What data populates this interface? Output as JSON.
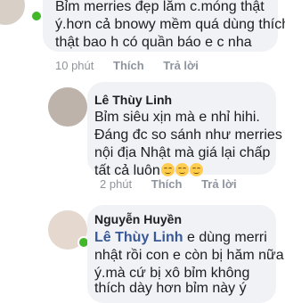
{
  "comments": [
    {
      "lines": [
        "Bỉm merries đẹp lắm c.móng thật",
        "ý.hơn cả bnowy mềm quá dùng thích",
        "thật bao h có quần báo e c nha"
      ],
      "time": "10 phút",
      "like": "Thích",
      "reply": "Trả lời"
    },
    {
      "author": "Lê Thùy Linh",
      "lines": [
        "Bỉm siêu xịn mà e nhỉ hihi.",
        "Đáng đc so sánh như merries",
        "nội địa Nhật mà giá lại chấp",
        "tất cả luôn"
      ],
      "emojis": [
        "smile-emoji",
        "smile-emoji",
        "smile-emoji"
      ],
      "time": "2 phút",
      "like": "Thích",
      "reply": "Trả lời"
    },
    {
      "author": "Nguyễn Huyền",
      "mention": "Lê Thùy Linh",
      "lines": [
        " e dùng merri",
        "nhật rồi con e còn bị hăm nữa",
        "ý.mà cứ bị xô bỉm không",
        "thích dày hơn bỉm này ý"
      ]
    }
  ],
  "colors": {
    "bubble": "#f0f2f5",
    "mention": "#385898",
    "meta": "#90949c",
    "online": "#42b72a"
  }
}
